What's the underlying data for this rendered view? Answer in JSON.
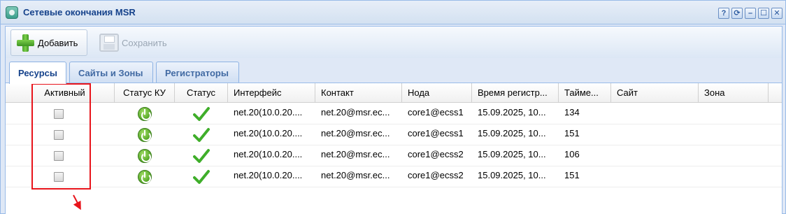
{
  "window": {
    "title": "Сетевые окончания MSR",
    "tools": [
      "?",
      "⟳",
      "–",
      "☐",
      "✕"
    ]
  },
  "toolbar": {
    "add_label": "Добавить",
    "save_label": "Сохранить"
  },
  "tabs": [
    {
      "label": "Ресурсы",
      "active": true
    },
    {
      "label": "Сайты и Зоны",
      "active": false
    },
    {
      "label": "Регистраторы",
      "active": false
    }
  ],
  "grid": {
    "columns": [
      "Активный",
      "Статус КУ",
      "Статус",
      "Интерфейс",
      "Контакт",
      "Нода",
      "Время регистр...",
      "Таймe...",
      "Сайт",
      "Зона"
    ],
    "rows": [
      {
        "active": false,
        "interface": "net.20(10.0.20....",
        "contact": "net.20@msr.ec...",
        "node": "core1@ecss1",
        "reg_time": "15.09.2025, 10...",
        "timer": "134",
        "site": "",
        "zone": ""
      },
      {
        "active": false,
        "interface": "net.20(10.0.20....",
        "contact": "net.20@msr.ec...",
        "node": "core1@ecss1",
        "reg_time": "15.09.2025, 10...",
        "timer": "151",
        "site": "",
        "zone": ""
      },
      {
        "active": false,
        "interface": "net.20(10.0.20....",
        "contact": "net.20@msr.ec...",
        "node": "core1@ecss2",
        "reg_time": "15.09.2025, 10...",
        "timer": "106",
        "site": "",
        "zone": ""
      },
      {
        "active": false,
        "interface": "net.20(10.0.20....",
        "contact": "net.20@msr.ec...",
        "node": "core1@ecss2",
        "reg_time": "15.09.2025, 10...",
        "timer": "151",
        "site": "",
        "zone": ""
      }
    ]
  },
  "colors": {
    "header_text": "#15428b",
    "frame_border": "#99bbe8",
    "highlight": "#e8141b",
    "status_ok": "#3fae2a"
  }
}
